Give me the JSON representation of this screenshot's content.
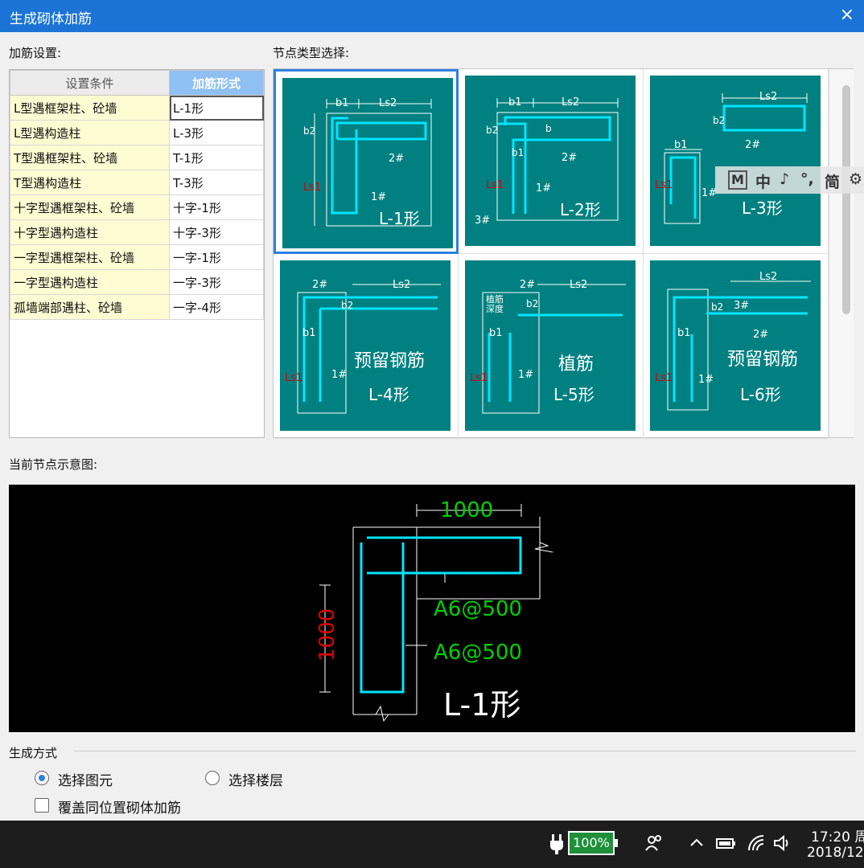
{
  "window": {
    "title": "生成砌体加筋",
    "close_icon": "×"
  },
  "settings": {
    "label": "加筋设置:",
    "headers": [
      "设置条件",
      "加筋形式"
    ],
    "rows": [
      {
        "condition": "L型遇框架柱、砼墙",
        "form": "L-1形"
      },
      {
        "condition": "L型遇构造柱",
        "form": "L-3形"
      },
      {
        "condition": "T型遇框架柱、砼墙",
        "form": "T-1形"
      },
      {
        "condition": "T型遇构造柱",
        "form": "T-3形"
      },
      {
        "condition": "十字型遇框架柱、砼墙",
        "form": "十字-1形"
      },
      {
        "condition": "十字型遇构造柱",
        "form": "十字-3形"
      },
      {
        "condition": "一字型遇框架柱、砼墙",
        "form": "一字-1形"
      },
      {
        "condition": "一字型遇构造柱",
        "form": "一字-3形"
      },
      {
        "condition": "孤墙端部遇柱、砼墙",
        "form": "一字-4形"
      }
    ]
  },
  "node_types": {
    "label": "节点类型选择:",
    "cards": [
      {
        "name": "L-1形",
        "caption": "",
        "dims": [
          "b1",
          "Ls2",
          "b2",
          "Ls1"
        ],
        "bars": [
          "2#",
          "1#"
        ]
      },
      {
        "name": "L-2形",
        "caption": "",
        "dims": [
          "b1",
          "Ls2",
          "b2",
          "Ls1"
        ],
        "bars": [
          "2#",
          "1#",
          "3#"
        ],
        "extra": [
          "b",
          "b1"
        ]
      },
      {
        "name": "L-3形",
        "caption": "",
        "dims": [
          "Ls2",
          "b2",
          "b1",
          "Ls1"
        ],
        "bars": [
          "2#",
          "1#"
        ]
      },
      {
        "name": "L-4形",
        "caption": "预留钢筋",
        "dims": [
          "Ls2",
          "b2",
          "b1",
          "Ls1"
        ],
        "bars": [
          "2#",
          "1#"
        ]
      },
      {
        "name": "L-5形",
        "caption": "植筋",
        "dims": [
          "Ls2",
          "b2",
          "b1",
          "Ls1"
        ],
        "bars": [
          "2#",
          "1#"
        ],
        "note": [
          "植筋",
          "深度"
        ]
      },
      {
        "name": "L-6形",
        "caption": "预留钢筋",
        "dims": [
          "Ls2",
          "b2",
          "b1",
          "Ls1"
        ],
        "bars": [
          "3#",
          "2#",
          "1#"
        ]
      }
    ]
  },
  "ime": {
    "items": [
      "M",
      "中",
      "♪",
      "°,",
      "简",
      "⚙"
    ]
  },
  "preview": {
    "label": "当前节点示意图:",
    "dim_top": "1000",
    "dim_left": "1000",
    "bar1": "A6@500",
    "bar2": "A6@500",
    "name": "L-1形"
  },
  "generate": {
    "label": "生成方式",
    "option1": "选择图元",
    "option2": "选择楼层",
    "overwrite": "覆盖同位置砌体加筋"
  },
  "taskbar": {
    "battery": "100%",
    "time": "17:20 周",
    "date": "2018/12"
  },
  "colors": {
    "card_bg": "#008080",
    "bar": "#00e5ff",
    "dim_green": "#00d000",
    "dim_red": "#e00000",
    "titlebar": "#1b73d6"
  }
}
